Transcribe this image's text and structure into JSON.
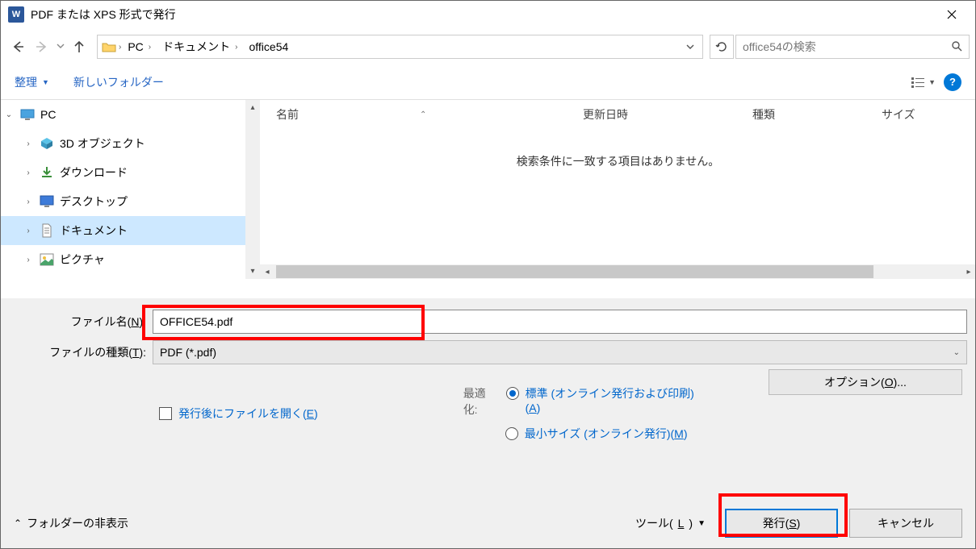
{
  "titlebar": {
    "app_icon_text": "W",
    "title": "PDF または XPS 形式で発行"
  },
  "nav": {
    "breadcrumb": [
      "PC",
      "ドキュメント",
      "office54"
    ],
    "search_placeholder": "office54の検索"
  },
  "toolbar": {
    "organize": "整理",
    "new_folder": "新しいフォルダー"
  },
  "tree": {
    "root": "PC",
    "items": [
      {
        "label": "3D オブジェクト",
        "icon": "cube"
      },
      {
        "label": "ダウンロード",
        "icon": "download"
      },
      {
        "label": "デスクトップ",
        "icon": "desktop"
      },
      {
        "label": "ドキュメント",
        "icon": "document",
        "selected": true
      },
      {
        "label": "ピクチャ",
        "icon": "pictures"
      }
    ]
  },
  "columns": {
    "name": "名前",
    "date": "更新日時",
    "type": "種類",
    "size": "サイズ"
  },
  "empty_message": "検索条件に一致する項目はありません。",
  "filename": {
    "label_pre": "ファイル名(",
    "label_u": "N",
    "label_post": "):",
    "value": "OFFICE54.pdf"
  },
  "filetype": {
    "label_pre": "ファイルの種類(",
    "label_u": "T",
    "label_post": "):",
    "value": "PDF (*.pdf)"
  },
  "open_after": {
    "label_pre": "発行後にファイルを開く(",
    "label_u": "E",
    "label_post": ")"
  },
  "optimize": {
    "label": "最適化:",
    "standard_pre": "標準 (オンライン発行および印刷)(",
    "standard_u": "A",
    "standard_post": ")",
    "min_pre": "最小サイズ (オンライン発行)(",
    "min_u": "M",
    "min_post": ")"
  },
  "options_button": {
    "pre": "オプション(",
    "u": "O",
    "post": ")..."
  },
  "footer": {
    "hide_folders": "フォルダーの非表示",
    "tools_pre": "ツール(",
    "tools_u": "L",
    "tools_post": ")",
    "publish_pre": "発行(",
    "publish_u": "S",
    "publish_post": ")",
    "cancel": "キャンセル"
  }
}
